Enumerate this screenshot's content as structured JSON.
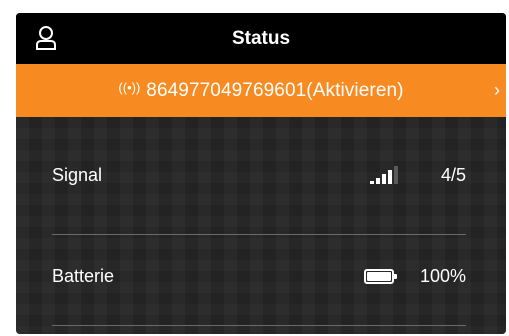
{
  "header": {
    "title": "Status",
    "user_icon": "user-icon"
  },
  "device": {
    "label": "864977049769601(Aktivieren)",
    "icon": "antenna-icon"
  },
  "rows": [
    {
      "label": "Signal",
      "value": "4/5",
      "signal_level": 4,
      "signal_max": 5
    },
    {
      "label": "Batterie",
      "value": "100%",
      "battery_level": 1.0
    }
  ],
  "colors": {
    "accent": "#f78a20",
    "background": "#262626",
    "topbar": "#000000"
  }
}
